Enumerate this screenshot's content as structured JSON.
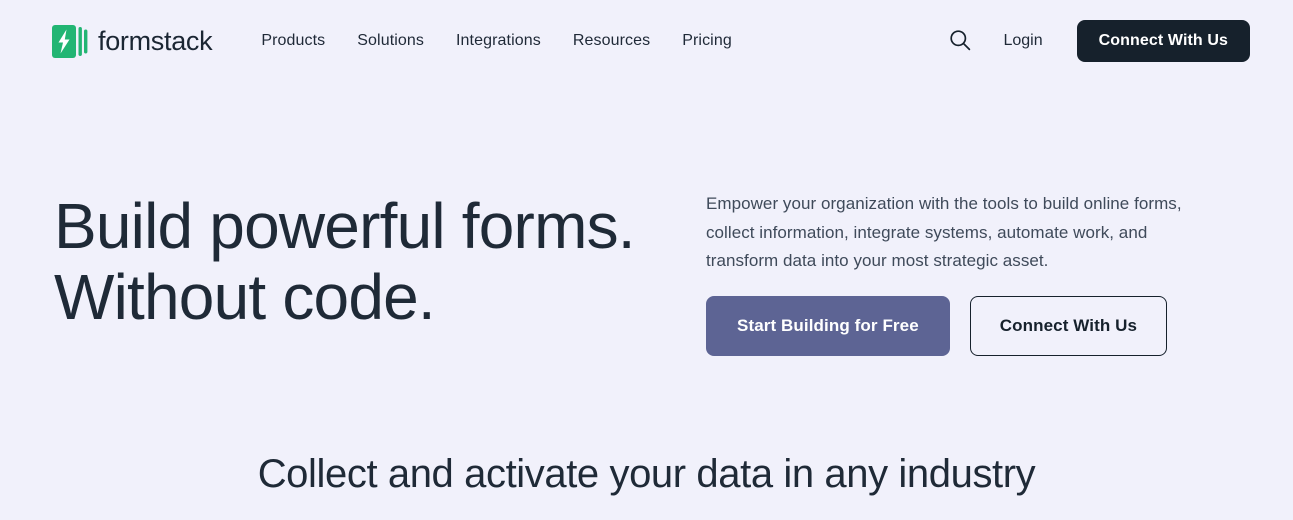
{
  "header": {
    "brand": {
      "logo_icon": "formstack-logo-icon",
      "wordmark": "formstack",
      "logo_color": "#22b573"
    },
    "nav": [
      {
        "label": "Products"
      },
      {
        "label": "Solutions"
      },
      {
        "label": "Integrations"
      },
      {
        "label": "Resources"
      },
      {
        "label": "Pricing"
      }
    ],
    "search_icon": "search-icon",
    "login_label": "Login",
    "cta_label": "Connect With Us",
    "cta_color": "#16212c"
  },
  "hero": {
    "title_line1": "Build powerful forms.",
    "title_line2": "Without code.",
    "paragraph_line1": "Empower your organization with the tools to build online forms,",
    "paragraph_line2": "collect information, integrate systems, automate work, and",
    "paragraph_line3": "transform data into your most strategic asset.",
    "primary_cta": "Start Building for Free",
    "secondary_cta": "Connect With Us",
    "primary_color": "#5d6494"
  },
  "section": {
    "heading": "Collect and activate your data in any industry"
  },
  "theme": {
    "background": "#f1f1fb",
    "text_dark": "#1f2a37",
    "text_muted": "#3f4a5a"
  }
}
